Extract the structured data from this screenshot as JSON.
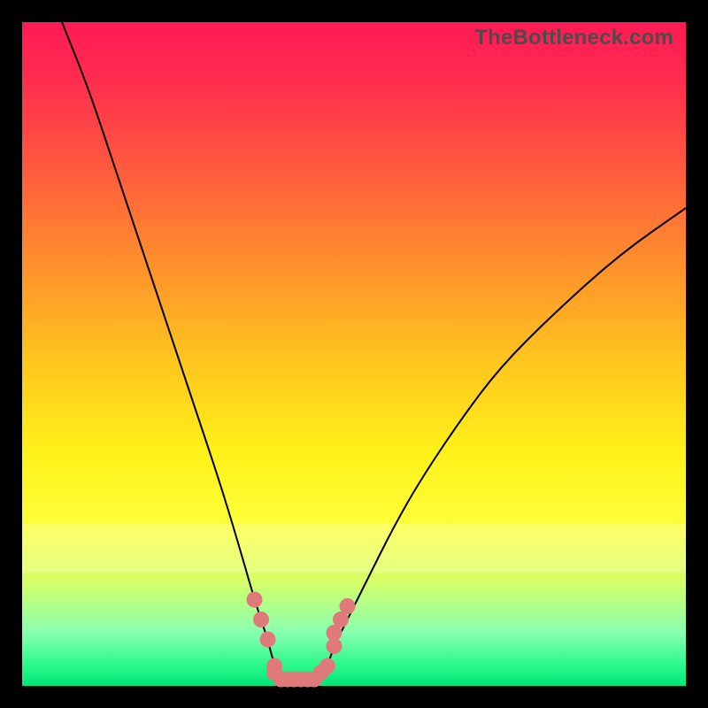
{
  "watermark": "TheBottleneck.com",
  "chart_data": {
    "type": "line",
    "title": "",
    "xlabel": "",
    "ylabel": "",
    "xlim": [
      0,
      100
    ],
    "ylim": [
      0,
      100
    ],
    "grid": false,
    "legend": false,
    "series": [
      {
        "name": "bottleneck-curve",
        "x": [
          6,
          10,
          14,
          18,
          22,
          26,
          30,
          33,
          35,
          37,
          38,
          40,
          42,
          44,
          46,
          47,
          49,
          52,
          56,
          60,
          66,
          72,
          80,
          90,
          100
        ],
        "values": [
          100,
          90,
          78,
          66,
          54,
          42,
          30,
          20,
          13,
          7,
          3,
          1,
          1,
          1,
          3,
          6,
          10,
          16,
          24,
          31,
          40,
          48,
          56,
          65,
          72
        ]
      },
      {
        "name": "highlight-dots",
        "x": [
          35,
          36,
          37,
          38,
          38,
          39,
          40,
          41,
          42,
          43,
          44,
          45,
          46,
          47,
          47,
          48,
          49
        ],
        "values": [
          13,
          10,
          7,
          3,
          2,
          1,
          1,
          1,
          1,
          1,
          1,
          2,
          3,
          6,
          8,
          10,
          12
        ]
      }
    ],
    "annotations": [],
    "background_gradient": {
      "type": "vertical",
      "stops": [
        {
          "pos": 0.0,
          "color": "#ff1a55"
        },
        {
          "pos": 0.5,
          "color": "#ffc21e"
        },
        {
          "pos": 0.76,
          "color": "#fdff3b"
        },
        {
          "pos": 1.0,
          "color": "#00e577"
        }
      ]
    }
  }
}
